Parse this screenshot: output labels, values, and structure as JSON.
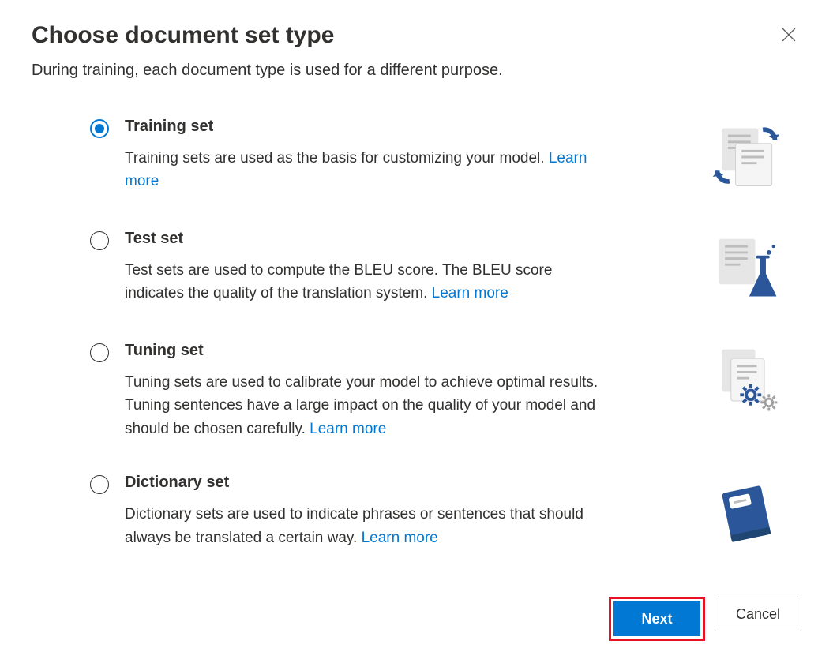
{
  "dialog": {
    "title": "Choose document set type",
    "subtitle": "During training, each document type is used for a different purpose."
  },
  "options": [
    {
      "id": "training",
      "label": "Training set",
      "desc": "Training sets are used as the basis for customizing your model. ",
      "learn": "Learn more",
      "selected": true,
      "icon": "training-icon"
    },
    {
      "id": "test",
      "label": "Test set",
      "desc": "Test sets are used to compute the BLEU score. The BLEU score indicates the quality of the translation system. ",
      "learn": "Learn more",
      "selected": false,
      "icon": "test-icon"
    },
    {
      "id": "tuning",
      "label": "Tuning set",
      "desc": "Tuning sets are used to calibrate your model to achieve optimal results. Tuning sentences have a large impact on the quality of your model and should be chosen carefully. ",
      "learn": "Learn more",
      "selected": false,
      "icon": "tuning-icon"
    },
    {
      "id": "dictionary",
      "label": "Dictionary set",
      "desc": "Dictionary sets are used to indicate phrases or sentences that should always be translated a certain way. ",
      "learn": "Learn more",
      "selected": false,
      "icon": "dictionary-icon"
    }
  ],
  "buttons": {
    "next": "Next",
    "cancel": "Cancel"
  }
}
